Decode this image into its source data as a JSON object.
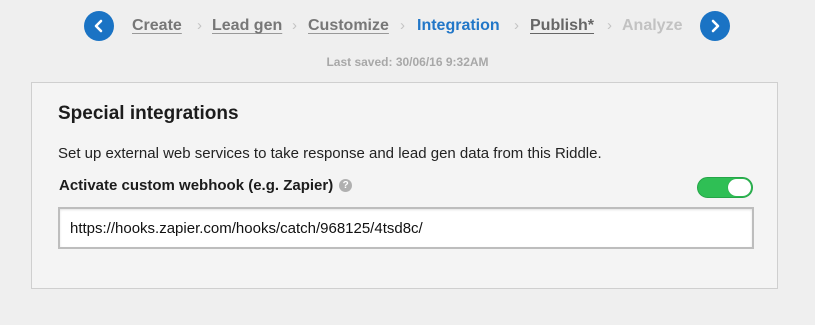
{
  "wizard": {
    "prev_icon": "chevron-left-icon",
    "next_icon": "chevron-right-icon",
    "separator": "›",
    "steps": [
      {
        "label": "Create",
        "state": "done"
      },
      {
        "label": "Lead gen",
        "state": "done"
      },
      {
        "label": "Customize",
        "state": "done"
      },
      {
        "label": "Integration",
        "state": "active"
      },
      {
        "label": "Publish*",
        "state": "pending"
      },
      {
        "label": "Analyze",
        "state": "disabled"
      }
    ],
    "last_saved": "Last saved: 30/06/16 9:32AM"
  },
  "panel": {
    "title": "Special integrations",
    "description": "Set up external web services to take response and lead gen data from this Riddle.",
    "webhook_label": "Activate custom webhook (e.g. Zapier)",
    "help_icon": "question-icon",
    "help_glyph": "?",
    "webhook_enabled": true,
    "webhook_url": "https://hooks.zapier.com/hooks/catch/968125/4tsd8c/"
  },
  "colors": {
    "accent": "#2277c8",
    "nav_button": "#1a73c4",
    "toggle_on": "#2fbf55",
    "muted": "#a8a8a8"
  }
}
